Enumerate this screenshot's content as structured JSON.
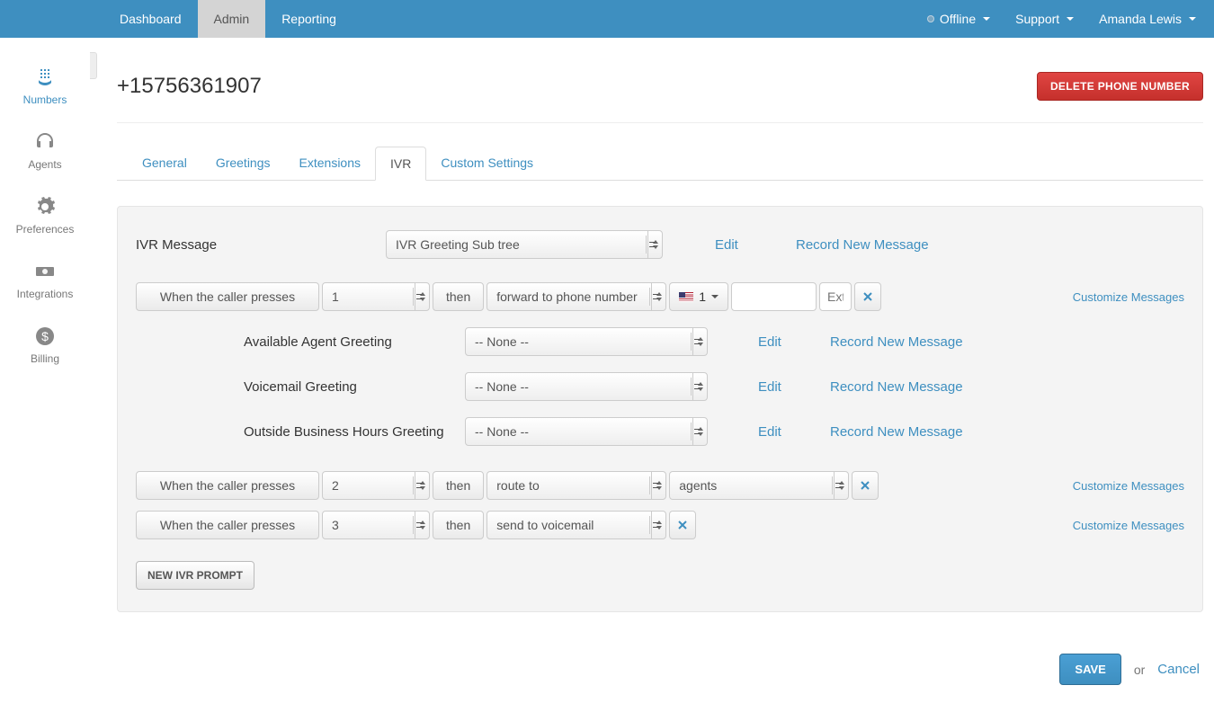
{
  "topnav": {
    "items": [
      "Dashboard",
      "Admin",
      "Reporting"
    ],
    "active_index": 1
  },
  "topbar_right": {
    "status_label": "Offline",
    "support_label": "Support",
    "user_name": "Amanda Lewis"
  },
  "sidebar": {
    "items": [
      {
        "label": "Numbers"
      },
      {
        "label": "Agents"
      },
      {
        "label": "Preferences"
      },
      {
        "label": "Integrations"
      },
      {
        "label": "Billing"
      }
    ],
    "active_index": 0
  },
  "page": {
    "title": "+15756361907",
    "delete_button_label": "DELETE PHONE NUMBER"
  },
  "tabs": {
    "items": [
      "General",
      "Greetings",
      "Extensions",
      "IVR",
      "Custom Settings"
    ],
    "active_index": 3
  },
  "ivr_message": {
    "label": "IVR Message",
    "select_value": "IVR Greeting Sub tree",
    "edit_label": "Edit",
    "record_label": "Record New Message"
  },
  "prompts": [
    {
      "when_label": "When the caller presses",
      "key": "1",
      "then_label": "then",
      "action": "forward to phone number",
      "country_code": "1",
      "phone_value": "",
      "ext_placeholder": "Ext.",
      "customize_label": "Customize Messages",
      "greetings": [
        {
          "label": "Available Agent Greeting",
          "value": "-- None --",
          "edit": "Edit",
          "record": "Record New Message"
        },
        {
          "label": "Voicemail Greeting",
          "value": "-- None --",
          "edit": "Edit",
          "record": "Record New Message"
        },
        {
          "label": "Outside Business Hours Greeting",
          "value": "-- None --",
          "edit": "Edit",
          "record": "Record New Message"
        }
      ]
    },
    {
      "when_label": "When the caller presses",
      "key": "2",
      "then_label": "then",
      "action": "route to",
      "target": "agents",
      "customize_label": "Customize Messages"
    },
    {
      "when_label": "When the caller presses",
      "key": "3",
      "then_label": "then",
      "action": "send to voicemail",
      "customize_label": "Customize Messages"
    }
  ],
  "new_prompt_button_label": "NEW IVR PROMPT",
  "footer": {
    "save_label": "SAVE",
    "or_label": "or",
    "cancel_label": "Cancel"
  }
}
